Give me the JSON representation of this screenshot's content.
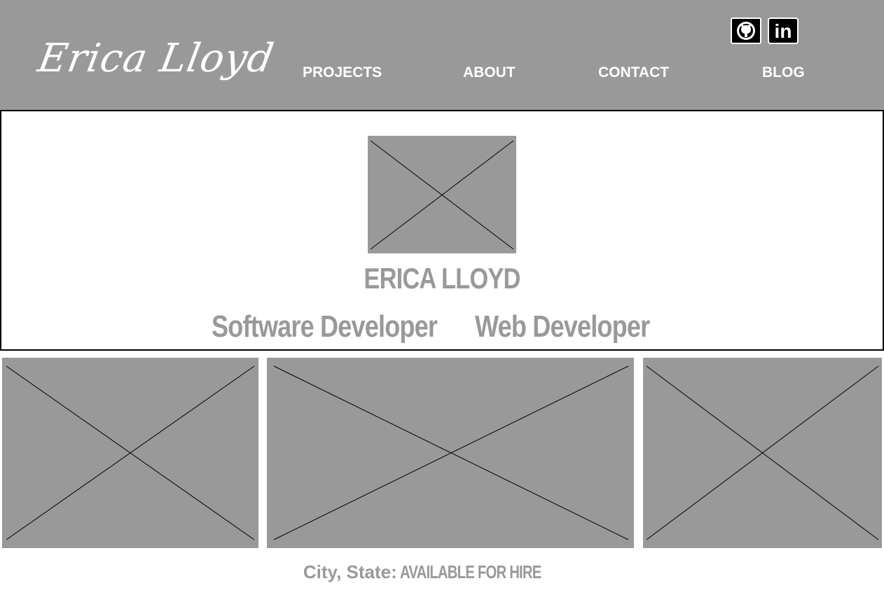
{
  "header": {
    "logo": "Erica Lloyd",
    "nav": [
      "PROJECTS",
      "ABOUT",
      "CONTACT",
      "BLOG"
    ],
    "social": [
      {
        "name": "GitHub",
        "icon": "github-icon"
      },
      {
        "name": "LinkedIn",
        "icon": "linkedin-icon",
        "text": "in"
      }
    ]
  },
  "hero": {
    "name": "ERICA LLOYD",
    "roles": [
      "Software Developer",
      "Web Developer"
    ]
  },
  "footer": {
    "location": "City, State:",
    "status": "AVAILABLE FOR HIRE"
  },
  "colors": {
    "header_bg": "#999999",
    "text_gray": "#999999",
    "placeholder": "#999999"
  }
}
